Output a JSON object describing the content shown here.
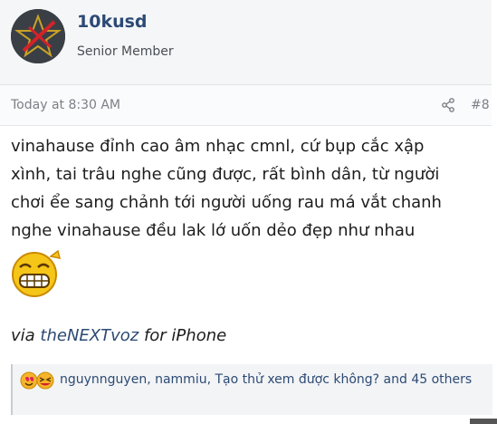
{
  "author": {
    "username": "10kusd",
    "title": "Senior Member"
  },
  "post": {
    "timestamp": "Today at 8:30 AM",
    "number": "#8",
    "body_lines": [
      "vinahause đỉnh cao âm nhạc cmnl, cứ bụp cắc xập",
      "xình, tai trâu nghe cũng được, rất bình dân, từ người",
      "chơi ểe sang chảnh tới người uống rau má vắt chanh",
      "nghe vinahause đều lak lớ uốn dẻo đẹp như nhau"
    ],
    "via_prefix": "via ",
    "via_app": "theNEXTvoz",
    "via_suffix": " for iPhone"
  },
  "reactions": {
    "text": "nguynnguyen, nammiu, Tạo thử xem được không? and 45 others"
  },
  "icons": {
    "avatar": "star-avatar-icon",
    "share": "share-icon",
    "emoji": "grinning-emoji-icon",
    "reaction1": "love-reaction-icon",
    "reaction2": "haha-reaction-icon"
  },
  "colors": {
    "link": "#2c4a74",
    "muted": "#7b8087",
    "accent_red": "#d2232a"
  }
}
